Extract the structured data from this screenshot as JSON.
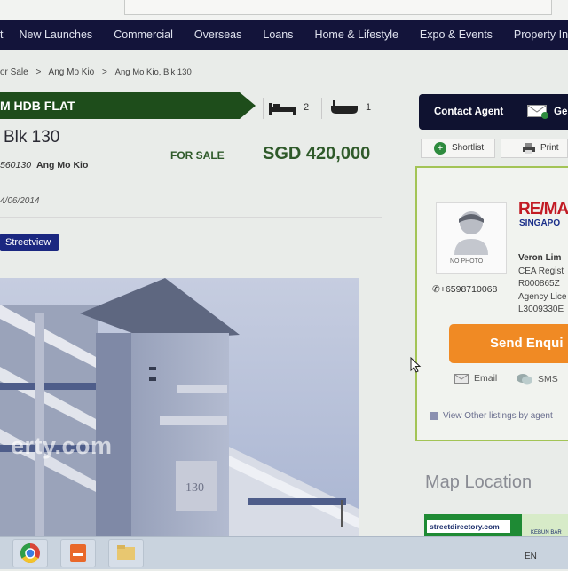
{
  "nav": {
    "items": [
      "t",
      "New Launches",
      "Commercial",
      "Overseas",
      "Loans",
      "Home & Lifestyle",
      "Expo & Events",
      "Property In"
    ]
  },
  "breadcrumb": {
    "items": [
      "or Sale",
      ">",
      "Ang Mo Kio",
      ">",
      "Ang Mo Kio, Blk 130"
    ]
  },
  "listing": {
    "type_label": "M HDB FLAT",
    "bedrooms": "2",
    "bathrooms": "1",
    "title": "Blk 130",
    "postal": "560130",
    "district": "Ang Mo Kio",
    "status": "FOR SALE",
    "price": "SGD 420,000",
    "date": "4/06/2014",
    "streetview_label": "Streetview",
    "watermark": "erty.com",
    "block_sign": "130"
  },
  "contact": {
    "contact_agent_label": "Contact Agent",
    "get_label": "Ge",
    "shortlist_label": "Shortlist",
    "print_label": "Print",
    "no_photo_label": "NO PHOTO",
    "phone": "+6598710068",
    "agency_logo_top": "RE/MA",
    "agency_logo_bottom": "SINGAPO",
    "agent_name": "Veron Lim",
    "agent_lines": [
      "CEA Regist",
      "R000865Z",
      "Agency Lice",
      "L3009330E"
    ],
    "send_enquiry_label": "Send Enqui",
    "email_label": "Email",
    "sms_label": "SMS",
    "view_other_label": "View Other listings by agent"
  },
  "map": {
    "heading": "Map Location",
    "streetdirectory_label": "streetdirectory.com",
    "map_snippet": "KEBUN BAR"
  },
  "taskbar": {
    "lang": "EN"
  },
  "colors": {
    "nav_bg": "#13143a",
    "type_bar": "#1e4d1b",
    "price_green": "#2f5a2a",
    "enquiry_orange": "#f08a24",
    "panel_border": "#a3c456",
    "streetview_blue": "#1a2780"
  }
}
